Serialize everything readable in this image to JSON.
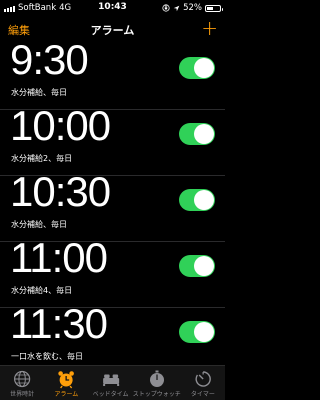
{
  "status": {
    "carrier": "SoftBank",
    "network": "4G",
    "time": "10:43",
    "battery": "52%",
    "battery_level": 0.52
  },
  "nav": {
    "edit": "編集",
    "title": "アラーム",
    "add": "+"
  },
  "alarms": [
    {
      "time": "9:30",
      "label": "水分補給、毎日",
      "enabled": true
    },
    {
      "time": "10:00",
      "label": "水分補給2、毎日",
      "enabled": true
    },
    {
      "time": "10:30",
      "label": "水分補給、毎日",
      "enabled": true
    },
    {
      "time": "11:00",
      "label": "水分補給4、毎日",
      "enabled": true
    },
    {
      "time": "11:30",
      "label": "一口水を飲む、毎日",
      "enabled": true
    }
  ],
  "tabs": [
    {
      "label": "世界時計",
      "icon": "globe-icon",
      "active": false
    },
    {
      "label": "アラーム",
      "icon": "alarm-clock-icon",
      "active": true
    },
    {
      "label": "ベッドタイム",
      "icon": "bed-icon",
      "active": false
    },
    {
      "label": "ストップウォッチ",
      "icon": "stopwatch-icon",
      "active": false
    },
    {
      "label": "タイマー",
      "icon": "timer-icon",
      "active": false
    }
  ],
  "colors": {
    "accent": "#ff9f0a",
    "toggle_on": "#30d158",
    "inactive": "#8e8e93",
    "background": "#000000"
  }
}
